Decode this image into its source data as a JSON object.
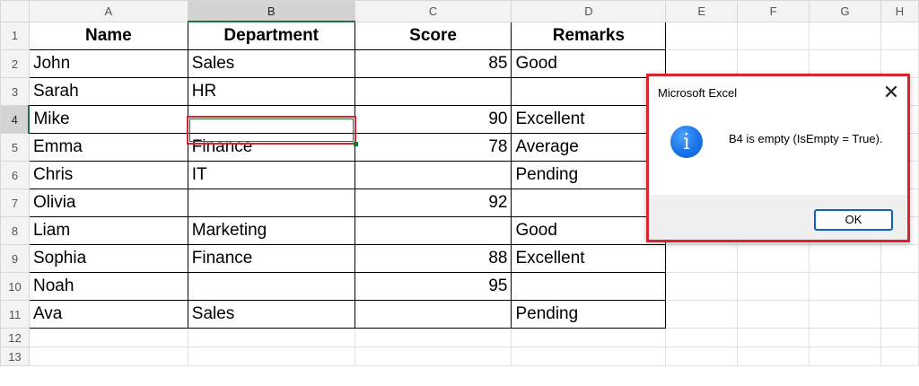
{
  "columns": [
    "A",
    "B",
    "C",
    "D",
    "E",
    "F",
    "G",
    "H"
  ],
  "rows": [
    "1",
    "2",
    "3",
    "4",
    "5",
    "6",
    "7",
    "8",
    "9",
    "10",
    "11",
    "12",
    "13"
  ],
  "table": {
    "headers": [
      "Name",
      "Department",
      "Score",
      "Remarks"
    ],
    "data": [
      [
        "John",
        "Sales",
        "85",
        "Good"
      ],
      [
        "Sarah",
        "HR",
        "",
        ""
      ],
      [
        "Mike",
        "",
        "90",
        "Excellent"
      ],
      [
        "Emma",
        "Finance",
        "78",
        "Average"
      ],
      [
        "Chris",
        "IT",
        "",
        "Pending"
      ],
      [
        "Olivia",
        "",
        "92",
        ""
      ],
      [
        "Liam",
        "Marketing",
        "",
        "Good"
      ],
      [
        "Sophia",
        "Finance",
        "88",
        "Excellent"
      ],
      [
        "Noah",
        "",
        "95",
        ""
      ],
      [
        "Ava",
        "Sales",
        "",
        "Pending"
      ]
    ]
  },
  "dialog": {
    "title": "Microsoft Excel",
    "close_glyph": "✕",
    "icon": "info-icon",
    "icon_glyph": "i",
    "message": "B4 is empty (IsEmpty = True).",
    "ok_label": "OK"
  },
  "colors": {
    "highlight_border": "#d9232d",
    "selection_green": "#1e7145",
    "ok_border": "#0a64c8"
  }
}
